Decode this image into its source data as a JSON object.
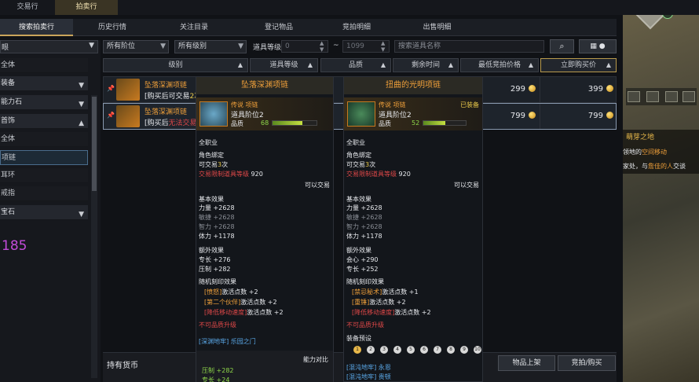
{
  "top_tabs": [
    "交易行",
    "拍卖行"
  ],
  "sub_tabs": [
    "搜索拍卖行",
    "历史行情",
    "关注目录",
    "登记物品",
    "竞拍明细",
    "出售明细"
  ],
  "sidebar": {
    "top_label": "眼",
    "categories": [
      {
        "label": "全体",
        "type": "sub"
      },
      {
        "label": "装备",
        "type": "cat",
        "chev": "▼"
      },
      {
        "label": "能力石",
        "type": "cat",
        "chev": "▼"
      },
      {
        "label": "首饰",
        "type": "cat",
        "chev": "▲"
      },
      {
        "label": "全体",
        "type": "sub"
      },
      {
        "label": "项链",
        "type": "sel"
      },
      {
        "label": "耳环",
        "type": "sub"
      },
      {
        "label": "戒指",
        "type": "sub"
      },
      {
        "label": "宝石",
        "type": "cat",
        "chev": "▼"
      }
    ],
    "purple_number": "185"
  },
  "filters": {
    "tier": "所有阶位",
    "grade": "所有级别",
    "item_level_label": "道具等级",
    "min_placeholder": "0",
    "max_placeholder": "1099",
    "tilde": "~",
    "search_placeholder": "搜索道具名称"
  },
  "columns": [
    "级别",
    "道具等级",
    "品质",
    "剩余时间",
    "最低竞拍价格",
    "立即购买价"
  ],
  "rows": [
    {
      "name": "坠落深渊项链",
      "note_a": "[购买后可交易",
      "note_b": "2次",
      "bid": "299",
      "buyout": "399"
    },
    {
      "name": "坠落深渊项链",
      "note_a": "[购买后",
      "note_b": "无法交易",
      "bid": "799",
      "buyout": "799"
    }
  ],
  "tooltip_left": {
    "title": "坠落深渊项链",
    "grade_type": "传说 项链",
    "tier": "道具阶位2",
    "quality_label": "品质",
    "quality": 68,
    "class": "全职业",
    "bound": "角色绑定",
    "trade_a": "可交易",
    "trade_n": "3",
    "trade_b": "次",
    "limit_label": "交易限制道具等级",
    "limit": "920",
    "tradable": "可以交易",
    "base_label": "基本效果",
    "stat1": "力量 +2628",
    "stat2": "敏捷 +2628",
    "stat3": "智力 +2628",
    "stat4": "体力 +1178",
    "extra_label": "额外效果",
    "extra1": "专长 +276",
    "extra2": "压制 +282",
    "engrave_label": "随机刻印效果",
    "eng1_name": "[愤怒]",
    "eng1_val": "激活点数 +2",
    "eng2_name": "[第二个伙伴]",
    "eng2_val": "激活点数 +2",
    "eng3_name": "[降低移动速度]",
    "eng3_val": "激活点数 +2",
    "no_upgrade": "不可品质升级",
    "source": "[深渊地牢] 乐园之门",
    "compare": "能力对比",
    "cmp1": "压制 +282",
    "cmp2": "专长 +24"
  },
  "tooltip_right": {
    "title": "扭曲的光明项链",
    "grade_type": "传说 项链",
    "equipped": "已装备",
    "tier": "道具阶位2",
    "quality_label": "品质",
    "quality": 52,
    "class": "全职业",
    "bound": "角色绑定",
    "trade_a": "可交易",
    "trade_n": "3",
    "trade_b": "次",
    "limit_label": "交易限制道具等级",
    "limit": "920",
    "tradable": "可以交易",
    "base_label": "基本效果",
    "stat1": "力量 +2628",
    "stat2": "敏捷 +2628",
    "stat3": "智力 +2628",
    "stat4": "体力 +1178",
    "extra_label": "额外效果",
    "extra1": "会心 +290",
    "extra2": "专长 +252",
    "engrave_label": "随机刻印效果",
    "eng1_name": "[禁忌秘术]",
    "eng1_val": "激活点数 +1",
    "eng2_name": "[重锤]",
    "eng2_val": "激活点数 +2",
    "eng3_name": "[降低移动速度]",
    "eng3_val": "激活点数 +2",
    "no_upgrade": "不可品质升级",
    "presets_label": "装备预设",
    "presets": [
      "1",
      "2",
      "3",
      "4",
      "5",
      "6",
      "7",
      "8",
      "9",
      "10"
    ],
    "source1": "[混沌地牢] 永恩",
    "source2": "[混沌地牢] 贵顿"
  },
  "footer": {
    "currency_label": "持有货币",
    "list_button": "物品上架",
    "bid_button": "竞拍/购买"
  },
  "right_panel": {
    "zone": "萌芽之地",
    "line1a": "领地的",
    "line1b": "空间移动",
    "line2a": "家处，与",
    "line2b": "詹佳的人",
    "line2c": "交谈"
  }
}
